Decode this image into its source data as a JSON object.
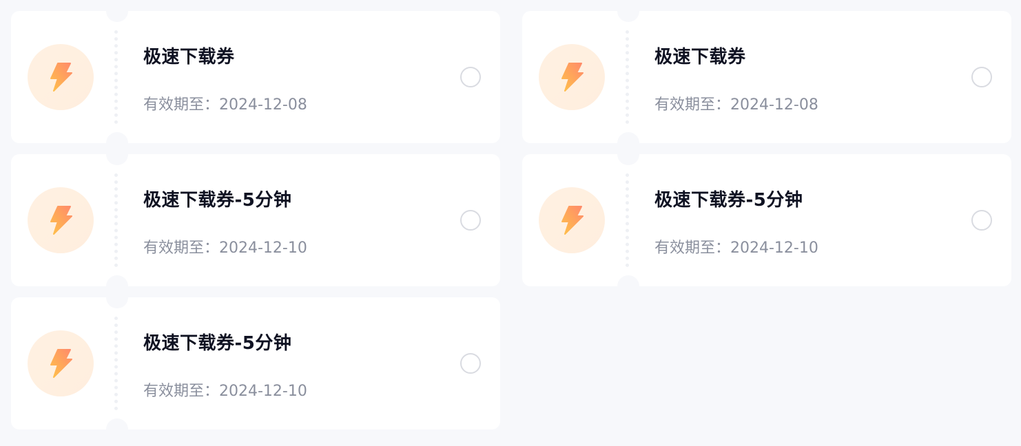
{
  "colors": {
    "page_background": "#f7f8fb",
    "card_background": "#ffffff",
    "title_text": "#0f1222",
    "expiry_text": "#8a8f9d",
    "icon_bg": "#fff1e2",
    "bolt_start": "#ffc24a",
    "bolt_end": "#ff8a6b",
    "radio_border": "#d9dbe1"
  },
  "coupons": [
    {
      "title": "极速下载券",
      "expiry": "有效期至：2024-12-08",
      "icon": "lightning-bolt-icon",
      "selected": false
    },
    {
      "title": "极速下载券",
      "expiry": "有效期至：2024-12-08",
      "icon": "lightning-bolt-icon",
      "selected": false
    },
    {
      "title": "极速下载券-5分钟",
      "expiry": "有效期至：2024-12-10",
      "icon": "lightning-bolt-icon",
      "selected": false
    },
    {
      "title": "极速下载券-5分钟",
      "expiry": "有效期至：2024-12-10",
      "icon": "lightning-bolt-icon",
      "selected": false
    },
    {
      "title": "极速下载券-5分钟",
      "expiry": "有效期至：2024-12-10",
      "icon": "lightning-bolt-icon",
      "selected": false
    }
  ]
}
